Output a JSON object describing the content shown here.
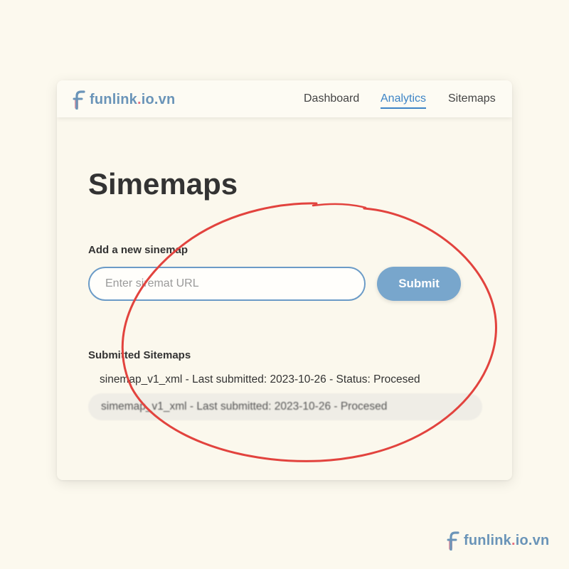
{
  "brand": {
    "name_prefix": "funlink",
    "name_dot": ".",
    "name_suffix": "io.vn"
  },
  "nav": {
    "items": [
      {
        "label": "Dashboard",
        "active": false
      },
      {
        "label": "Analytics",
        "active": true
      },
      {
        "label": "Sitemaps",
        "active": false
      }
    ]
  },
  "page": {
    "title": "Simemaps"
  },
  "form": {
    "label": "Add a new sinemap",
    "input_value": "",
    "input_placeholder": "Enter siremat URL",
    "submit_label": "Submit"
  },
  "submitted": {
    "heading": "Submitted Sitemaps",
    "rows": [
      {
        "text": "sinemap_v1_xml - Last submitted: 2023-10-26 - Status: Procesed"
      },
      {
        "text": "simemap_v1_xml - Last submitted: 2023-10-26 - Procesed"
      }
    ]
  },
  "watermark": {
    "name_prefix": "funlink",
    "name_dot": ".",
    "name_suffix": "io.vn"
  },
  "colors": {
    "background": "#fcf9ee",
    "accent": "#3d84c6",
    "brand_blue": "#6a94b8",
    "brand_pink": "#e6707f",
    "button": "#78a6cc",
    "annotation_red": "#e2433e"
  },
  "icons": {
    "logo": "funlink-f-logo-icon"
  }
}
